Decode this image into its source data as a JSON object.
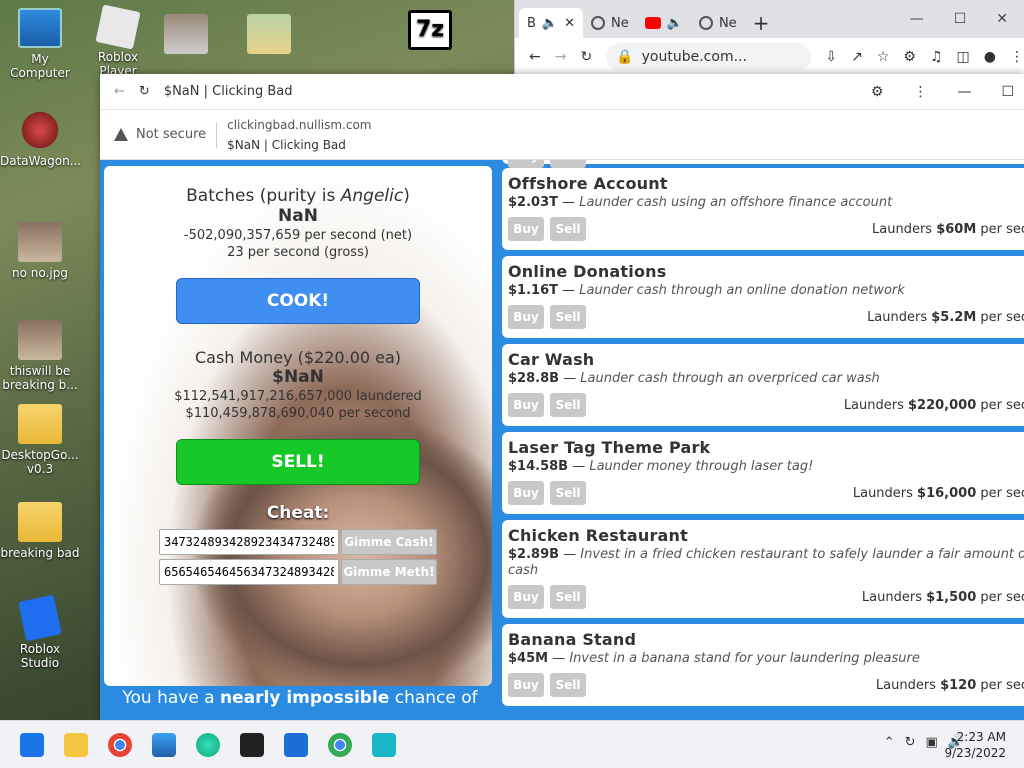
{
  "desktop": {
    "icons": [
      {
        "label": "My Computer"
      },
      {
        "label": "Roblox Player"
      },
      {
        "label": "DataWagon..."
      },
      {
        "label": "no no.jpg"
      },
      {
        "label": "thiswill be breaking b..."
      },
      {
        "label": "DesktopGo... v0.3"
      },
      {
        "label": "breaking bad"
      },
      {
        "label": "Roblox Studio"
      }
    ],
    "seven_zip": "7z"
  },
  "back_browser": {
    "tabs": [
      "B",
      "Ne",
      "Ne"
    ],
    "new_tab": "+",
    "url": "youtube.com..."
  },
  "browser": {
    "tab_title": "$NaN | Clicking Bad",
    "security": "Not secure",
    "domain": "clickingbad.nullism.com",
    "page_title": "$NaN | Clicking Bad"
  },
  "game": {
    "batches_prefix": "Batches (purity is ",
    "purity": "Angelic",
    "batches_suffix": ")",
    "batches_value": "NaN",
    "net_rate": "-502,090,357,659 per second (net)",
    "gross_rate": "23 per second (gross)",
    "cook_label": "COOK!",
    "cash_title": "Cash Money ($220.00 ea)",
    "cash_value": "$NaN",
    "laundered": "$112,541,917,216,657,000 laundered",
    "per_second": "$110,459,878,690,040 per second",
    "sell_label": "SELL!",
    "cheat_label": "Cheat:",
    "cash_input": "3473248934289234347324893428",
    "meth_input": "6565465464563473248934289234",
    "gimme_cash": "Gimme Cash!",
    "gimme_meth": "Gimme Meth!",
    "bottom_msg_a": "You have a ",
    "bottom_msg_b": "nearly impossible",
    "bottom_msg_c": " chance of"
  },
  "launder_items": [
    {
      "name": "Offshore Account",
      "price": "$2.03T",
      "dash": " — ",
      "desc": "Launder cash using an offshore finance account",
      "buy": "Buy",
      "sell": "Sell",
      "launders_pre": "Launders ",
      "amount": "$60M",
      "launders_post": " per seco"
    },
    {
      "name": "Online Donations",
      "price": "$1.16T",
      "dash": " — ",
      "desc": "Launder cash through an online donation network",
      "buy": "Buy",
      "sell": "Sell",
      "launders_pre": "Launders ",
      "amount": "$5.2M",
      "launders_post": " per seco"
    },
    {
      "name": "Car Wash",
      "price": "$28.8B",
      "dash": " — ",
      "desc": "Launder cash through an overpriced car wash",
      "buy": "Buy",
      "sell": "Sell",
      "launders_pre": "Launders ",
      "amount": "$220,000",
      "launders_post": " per seco"
    },
    {
      "name": "Laser Tag Theme Park",
      "price": "$14.58B",
      "dash": " — ",
      "desc": "Launder money through laser tag!",
      "buy": "Buy",
      "sell": "Sell",
      "launders_pre": "Launders ",
      "amount": "$16,000",
      "launders_post": " per seco"
    },
    {
      "name": "Chicken Restaurant",
      "price": "$2.89B",
      "dash": " — ",
      "desc": "Invest in a fried chicken restaurant to safely launder a fair amount of cash",
      "buy": "Buy",
      "sell": "Sell",
      "launders_pre": "Launders ",
      "amount": "$1,500",
      "launders_post": " per seco"
    },
    {
      "name": "Banana Stand",
      "price": "$45M",
      "dash": " — ",
      "desc": "Invest in a banana stand for your laundering pleasure",
      "buy": "Buy",
      "sell": "Sell",
      "launders_pre": "Launders ",
      "amount": "$120",
      "launders_post": " per seco"
    }
  ],
  "partial_item": {
    "buy": "Buy",
    "sell": "Sell"
  },
  "taskbar": {
    "time": "2:23 AM",
    "date": "9/23/2022"
  }
}
